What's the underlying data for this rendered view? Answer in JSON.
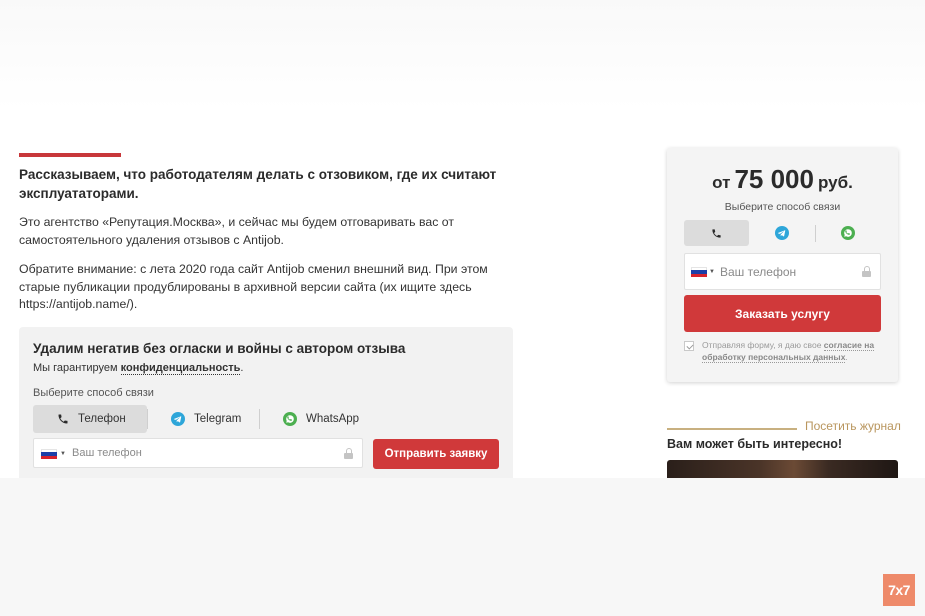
{
  "article": {
    "lead": "Рассказываем, что работодателям делать с отзовиком, где их считают эксплуататорами.",
    "paragraphs": [
      "Это агентство «Репутация.Москва», и сейчас мы будем отговаривать вас от самостоятельного удаления отзывов с Antijob.",
      "Обратите внимание: с лета 2020 года сайт Antijob сменил внешний вид. При этом старые публикации продублированы в архивной версии сайта (их ищите здесь https://antijob.name/)."
    ]
  },
  "form": {
    "title": "Удалим негатив без огласки и войны с автором отзыва",
    "guarantee_prefix": "Мы гарантируем ",
    "guarantee_link": "конфиденциальность",
    "guarantee_suffix": ".",
    "choose_label": "Выберите способ связи",
    "tabs": [
      {
        "label": "Телефон",
        "icon": "phone-icon",
        "active": true
      },
      {
        "label": "Telegram",
        "icon": "telegram-icon",
        "active": false
      },
      {
        "label": "WhatsApp",
        "icon": "whatsapp-icon",
        "active": false
      }
    ],
    "phone_placeholder": "Ваш телефон",
    "submit_label": "Отправить заявку"
  },
  "price_card": {
    "from": "от",
    "amount": "75 000",
    "currency": "руб.",
    "choose_label": "Выберите способ связи",
    "tabs": [
      {
        "icon": "phone-icon",
        "active": true
      },
      {
        "icon": "telegram-icon",
        "active": false
      },
      {
        "icon": "whatsapp-icon",
        "active": false
      }
    ],
    "phone_placeholder": "Ваш телефон",
    "order_label": "Заказать услугу",
    "consent_prefix": "Отправляя форму, я даю свое ",
    "consent_link": "согласие на обработку персональных данных",
    "consent_suffix": "."
  },
  "journal": {
    "link": "Посетить журнал",
    "heading": "Вам может быть интересно!"
  },
  "badge": "7x7",
  "colors": {
    "accent_red": "#d0393a",
    "journal_gold": "#b9965e",
    "telegram": "#2ea6d9",
    "whatsapp": "#4caf50"
  }
}
